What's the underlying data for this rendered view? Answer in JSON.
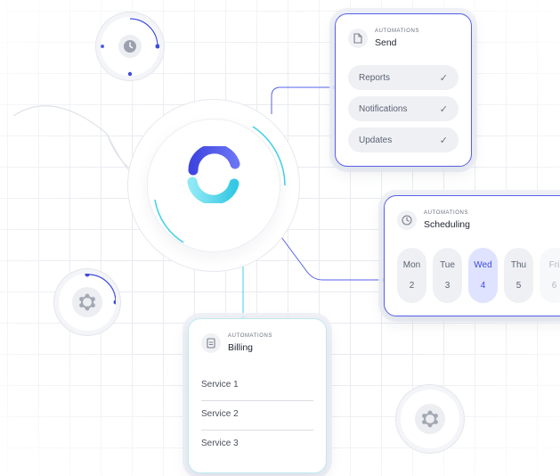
{
  "send_card": {
    "eyebrow": "AUTOMATIONS",
    "title": "Send",
    "icon": "document-icon",
    "items": [
      {
        "label": "Reports",
        "checked": true
      },
      {
        "label": "Notifications",
        "checked": true
      },
      {
        "label": "Updates",
        "checked": true
      }
    ]
  },
  "scheduling_card": {
    "eyebrow": "AUTOMATIONS",
    "title": "Scheduling",
    "icon": "clock-icon",
    "days": [
      {
        "name": "Mon",
        "date": "2"
      },
      {
        "name": "Tue",
        "date": "3"
      },
      {
        "name": "Wed",
        "date": "4",
        "selected": true
      },
      {
        "name": "Thu",
        "date": "5"
      },
      {
        "name": "Fri",
        "date": "6"
      }
    ]
  },
  "billing_card": {
    "eyebrow": "AUTOMATIONS",
    "title": "Billing",
    "icon": "receipt-icon",
    "services": [
      "Service 1",
      "Service 2",
      "Service 3"
    ]
  },
  "hub": {
    "icon": "loop-logo-icon"
  },
  "nodes": {
    "top_left": "clock-icon",
    "left": "hub-network-icon",
    "bottom_right": "hub-network-icon"
  },
  "colors": {
    "accent": "#5561e8",
    "accent_cyan": "#3fd0e6",
    "selected_day_bg": "#dfe3ff",
    "pill_bg": "#eef0f4"
  }
}
